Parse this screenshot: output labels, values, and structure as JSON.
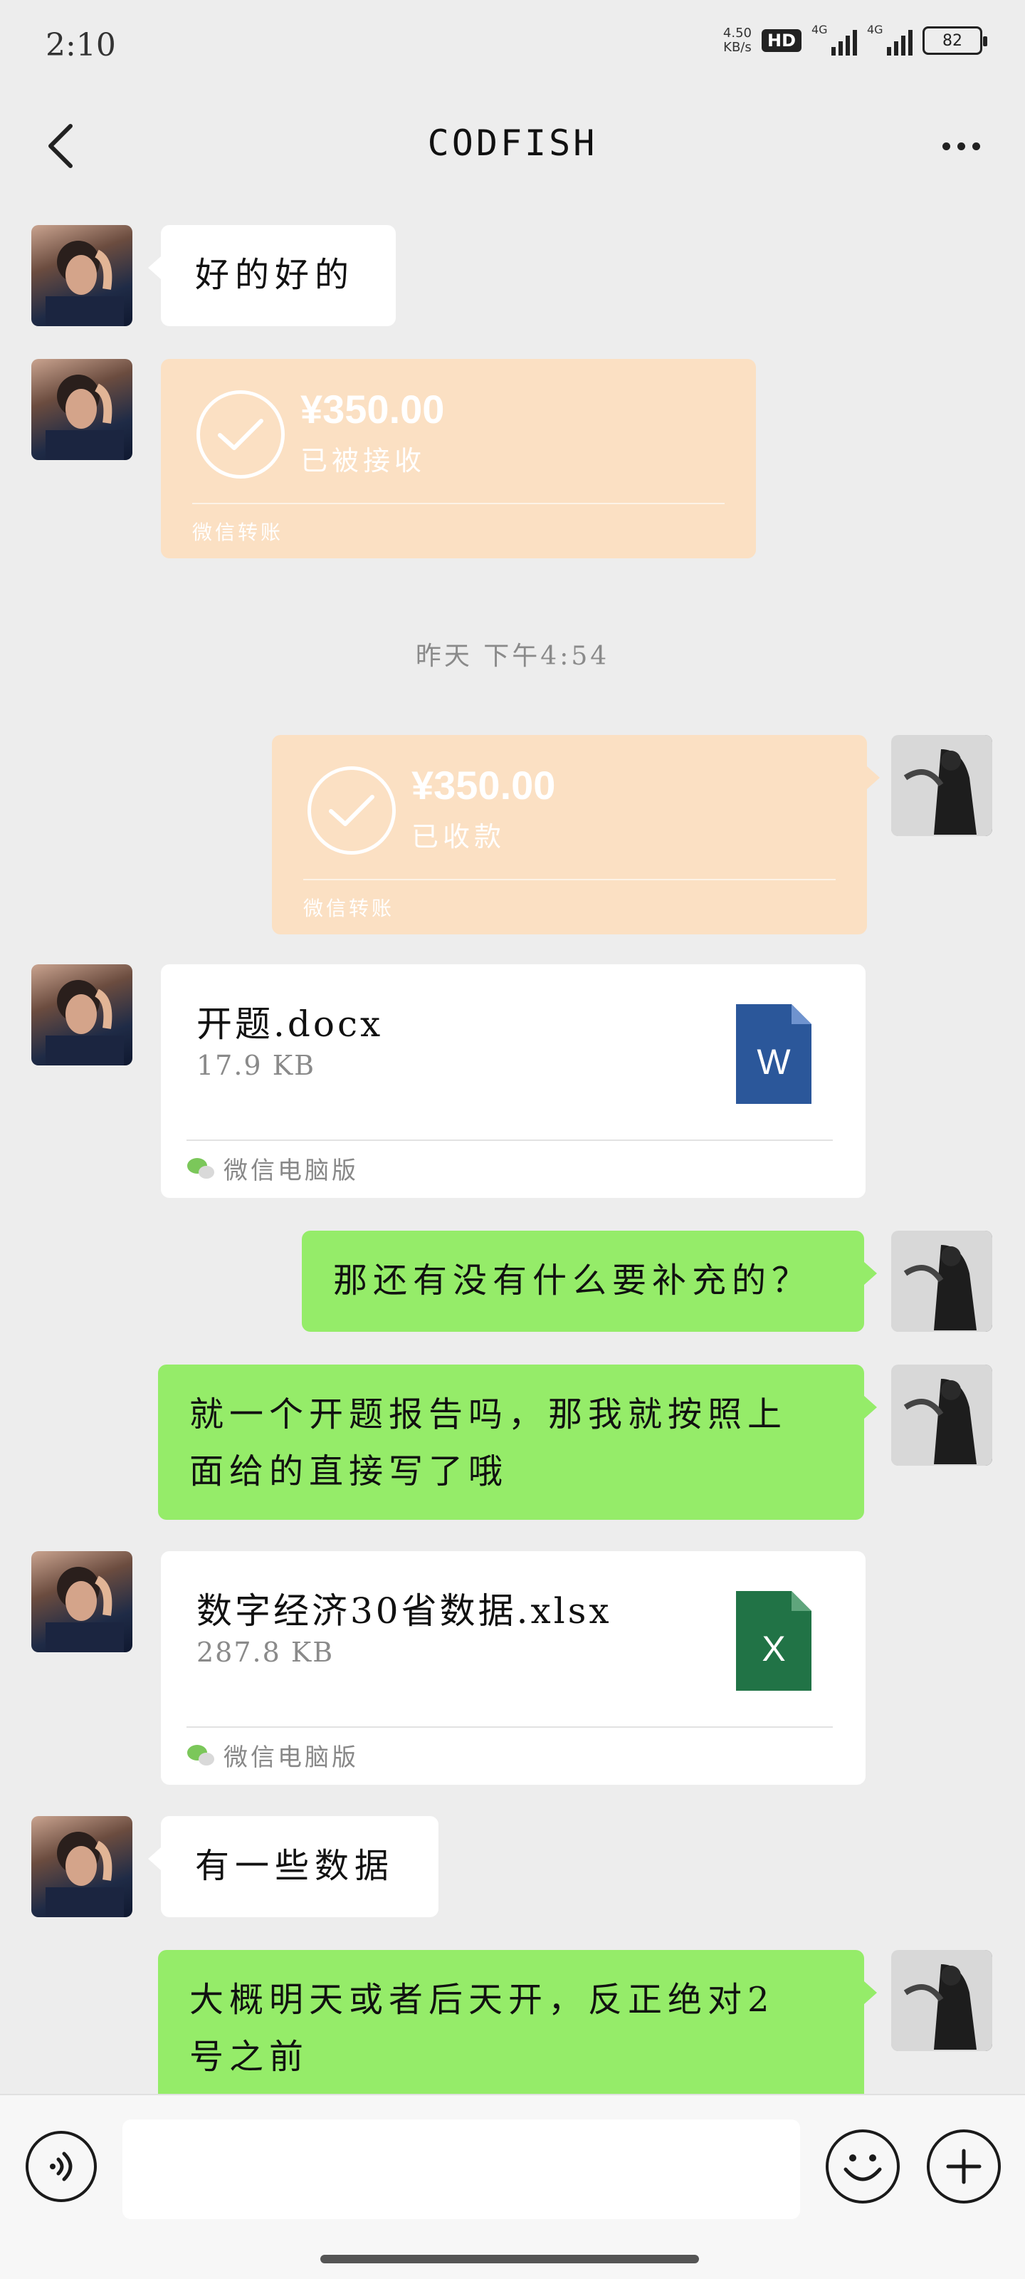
{
  "status_bar": {
    "time": "2:10",
    "net_speed_value": "4.50",
    "net_speed_unit": "KB/s",
    "hd_badge": "HD",
    "signal1_label": "4G",
    "signal2_label": "4G",
    "battery": "82"
  },
  "nav": {
    "title": "CODFISH",
    "back_icon": "chevron-left-icon",
    "more_icon": "more-dots-icon"
  },
  "messages": [
    {
      "type": "text",
      "from": "other",
      "text": "好的好的"
    },
    {
      "type": "transfer",
      "from": "other",
      "amount": "¥350.00",
      "status": "已被接收",
      "label": "微信转账"
    },
    {
      "type": "timestamp",
      "text": "昨天 下午4:54"
    },
    {
      "type": "transfer",
      "from": "self",
      "amount": "¥350.00",
      "status": "已收款",
      "label": "微信转账"
    },
    {
      "type": "file",
      "from": "other",
      "name": "开题.docx",
      "size": "17.9 KB",
      "file_icon": "word-icon",
      "icon_letter": "W",
      "source": "微信电脑版"
    },
    {
      "type": "text",
      "from": "self",
      "text": "那还有没有什么要补充的？"
    },
    {
      "type": "text",
      "from": "self",
      "line1": "就一个开题报告吗，那我就按照上",
      "line2": "面给的直接写了哦"
    },
    {
      "type": "file",
      "from": "other",
      "name": "数字经济30省数据.xlsx",
      "size": "287.8 KB",
      "file_icon": "excel-icon",
      "icon_letter": "X",
      "source": "微信电脑版"
    },
    {
      "type": "text",
      "from": "other",
      "text": "有一些数据"
    },
    {
      "type": "text",
      "from": "self",
      "line1": "大概明天或者后天开，反正绝对2",
      "line2": "号之前"
    }
  ],
  "input_bar": {
    "placeholder": "",
    "voice_icon": "voice-icon",
    "emoji_icon": "emoji-icon",
    "plus_icon": "plus-icon"
  },
  "colors": {
    "background": "#ededed",
    "green_bubble": "#95ec69",
    "transfer_bubble": "#fbe0c3",
    "word_blue": "#2b579a",
    "excel_green": "#217346"
  }
}
